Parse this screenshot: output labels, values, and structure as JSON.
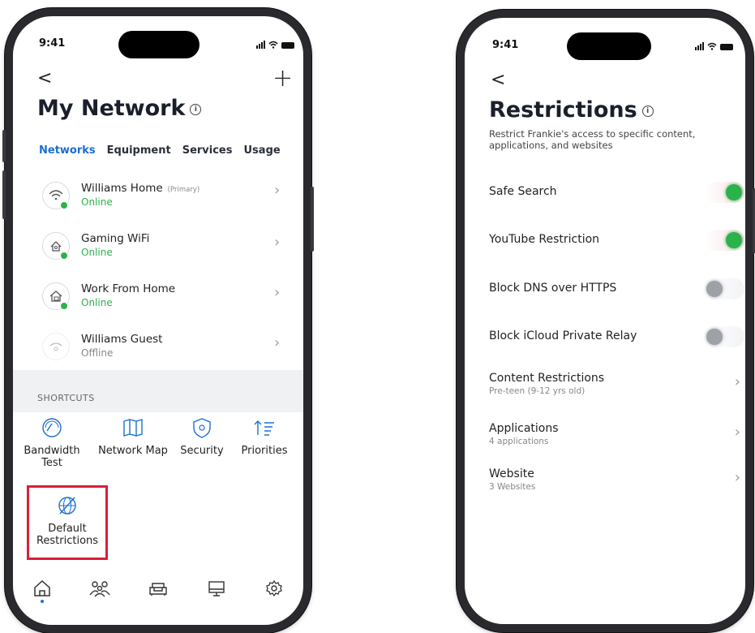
{
  "left_phone": {
    "status": {
      "time": "9:41"
    },
    "header": {
      "back": "<",
      "add": "+",
      "title": "My Network",
      "info": "i"
    },
    "tabs": [
      {
        "label": "Networks",
        "active": true
      },
      {
        "label": "Equipment",
        "active": false
      },
      {
        "label": "Services",
        "active": false
      },
      {
        "label": "Usage",
        "active": false
      }
    ],
    "networks": [
      {
        "name": "Williams Home",
        "tag": "(Primary)",
        "status": "Online",
        "icon": "wifi-icon"
      },
      {
        "name": "Gaming WiFi",
        "tag": "",
        "status": "Online",
        "icon": "gaming-network-icon"
      },
      {
        "name": "Work From Home",
        "tag": "",
        "status": "Online",
        "icon": "work-home-icon"
      },
      {
        "name": "Williams Guest",
        "tag": "",
        "status": "Offline",
        "icon": "guest-network-icon"
      }
    ],
    "shortcuts": {
      "label": "SHORTCUTS",
      "items": [
        {
          "label": "Bandwidth Test",
          "icon": "speedometer-icon"
        },
        {
          "label": "Network Map",
          "icon": "map-icon"
        },
        {
          "label": "Security",
          "icon": "shield-icon"
        },
        {
          "label": "Priorities",
          "icon": "priorities-icon"
        },
        {
          "label": "Default Restrictions",
          "icon": "restricted-globe-icon"
        }
      ]
    },
    "bottom_nav": [
      {
        "icon": "home-icon",
        "active": true
      },
      {
        "icon": "people-icon",
        "active": false
      },
      {
        "icon": "couch-icon",
        "active": false
      },
      {
        "icon": "monitor-icon",
        "active": false
      },
      {
        "icon": "gear-icon",
        "active": false
      }
    ],
    "highlight_color": "#d91f37",
    "accent": "#1b6fd1",
    "online_color": "#2bb24c"
  },
  "right_phone": {
    "status": {
      "time": "9:41"
    },
    "header": {
      "back": "<",
      "title": "Restrictions",
      "info": "i"
    },
    "subtitle": "Restrict Frankie's access to specific content, applications, and websites",
    "toggles": [
      {
        "label": "Safe Search",
        "on": true
      },
      {
        "label": "YouTube Restriction",
        "on": true
      },
      {
        "label": "Block DNS over HTTPS",
        "on": false
      },
      {
        "label": "Block iCloud Private Relay",
        "on": false
      }
    ],
    "links": [
      {
        "label": "Content Restrictions",
        "sub": "Pre-teen (9-12 yrs old)"
      },
      {
        "label": "Applications",
        "sub": "4 applications"
      },
      {
        "label": "Website",
        "sub": "3 Websites"
      }
    ]
  }
}
